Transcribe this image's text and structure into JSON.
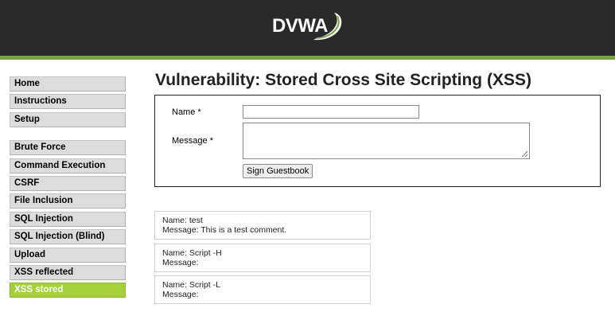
{
  "header": {
    "logo_text": "DVWA",
    "background_color": "#2a2a2a",
    "stripe_color": "#7aa344"
  },
  "menu": {
    "group1": [
      {
        "label": "Home"
      },
      {
        "label": "Instructions"
      },
      {
        "label": "Setup"
      }
    ],
    "group2": [
      {
        "label": "Brute Force"
      },
      {
        "label": "Command Execution"
      },
      {
        "label": "CSRF"
      },
      {
        "label": "File Inclusion"
      },
      {
        "label": "SQL Injection"
      },
      {
        "label": "SQL Injection (Blind)"
      },
      {
        "label": "Upload"
      },
      {
        "label": "XSS reflected"
      },
      {
        "label": "XSS stored",
        "selected": true
      }
    ],
    "selected_color": "#a6cf3c"
  },
  "page": {
    "title": "Vulnerability: Stored Cross Site Scripting (XSS)"
  },
  "form": {
    "name_label": "Name *",
    "message_label": "Message *",
    "name_value": "",
    "message_value": "",
    "submit_label": "Sign Guestbook"
  },
  "guestbook": {
    "entries": [
      {
        "name": "Name: test",
        "message": "Message: This is a test comment."
      },
      {
        "name": "Name: Script -H",
        "message": "Message:"
      },
      {
        "name": "Name: Script -L",
        "message": "Message:"
      }
    ]
  }
}
